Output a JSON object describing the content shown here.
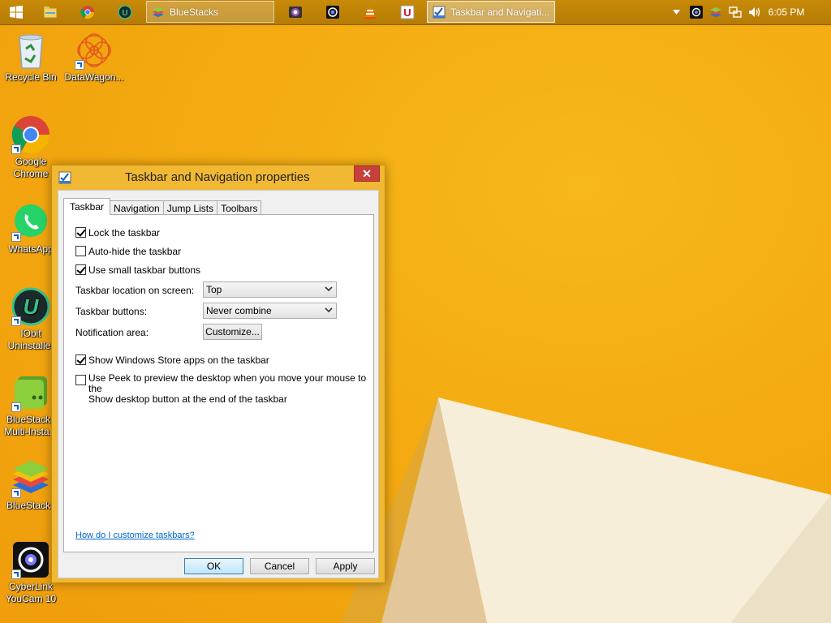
{
  "taskbar": {
    "pinned": [
      {
        "name": "start-icon"
      },
      {
        "name": "file-explorer-icon"
      },
      {
        "name": "chrome-icon"
      },
      {
        "name": "iobit-uninstaller-icon"
      }
    ],
    "windows": [
      {
        "label": "BlueStacks",
        "icon": "bluestacks-icon",
        "active": false
      },
      {
        "label": "Taskbar and Navigati...",
        "icon": "properties-icon",
        "active": true
      }
    ],
    "apps": [
      {
        "name": "camera-app-icon"
      },
      {
        "name": "circle-app-icon"
      },
      {
        "name": "vlc-icon"
      },
      {
        "name": "u-app-icon"
      }
    ],
    "tray": [
      {
        "name": "show-hidden-icons-chevron-icon"
      },
      {
        "name": "webcam-tray-icon"
      },
      {
        "name": "bluestacks-tray-icon"
      },
      {
        "name": "network-icon"
      },
      {
        "name": "volume-icon"
      }
    ],
    "clock": "6:05 PM"
  },
  "desktop_icons": [
    {
      "label": "Recycle Bin",
      "icon": "recycle-bin-icon"
    },
    {
      "label": "DataWagon...",
      "icon": "datawagon-icon"
    },
    {
      "label": "Google Chrome",
      "icon": "chrome-icon"
    },
    {
      "label": "WhatsApp",
      "icon": "whatsapp-icon"
    },
    {
      "label": "IObit Uninstaller",
      "icon": "iobit-uninstaller-icon"
    },
    {
      "label": "BlueStacks Multi-Insta...",
      "icon": "bluestacks-multi-instance-icon"
    },
    {
      "label": "BlueStacks",
      "icon": "bluestacks-icon"
    },
    {
      "label": "CyberLink YouCam 10",
      "icon": "youcam-icon"
    }
  ],
  "dialog": {
    "title": "Taskbar and Navigation properties",
    "close_label": "✕",
    "tabs": [
      "Taskbar",
      "Navigation",
      "Jump Lists",
      "Toolbars"
    ],
    "active_tab": "Taskbar",
    "options": {
      "lock_taskbar": {
        "label": "Lock the taskbar",
        "checked": true
      },
      "auto_hide": {
        "label": "Auto-hide the taskbar",
        "checked": false
      },
      "small_buttons": {
        "label": "Use small taskbar buttons",
        "checked": true
      },
      "store_apps": {
        "label": "Show Windows Store apps on the taskbar",
        "checked": true
      },
      "peek_line1": "Use Peek to preview the desktop when you move your mouse to the",
      "peek_line2": "Show desktop button at the end of the taskbar",
      "peek_checked": false
    },
    "location_label": "Taskbar location on screen:",
    "location_value": "Top",
    "buttons_label": "Taskbar buttons:",
    "buttons_value": "Never combine",
    "notification_label": "Notification area:",
    "customize_label": "Customize...",
    "help_link": "How do I customize taskbars?",
    "ok_label": "OK",
    "cancel_label": "Cancel",
    "apply_label": "Apply"
  },
  "colors": {
    "wallpaper": "#f4ae12",
    "taskbar": "#b87d06",
    "dialog_frame": "#f0b833",
    "close_button": "#c7403a",
    "link": "#0066cc"
  }
}
